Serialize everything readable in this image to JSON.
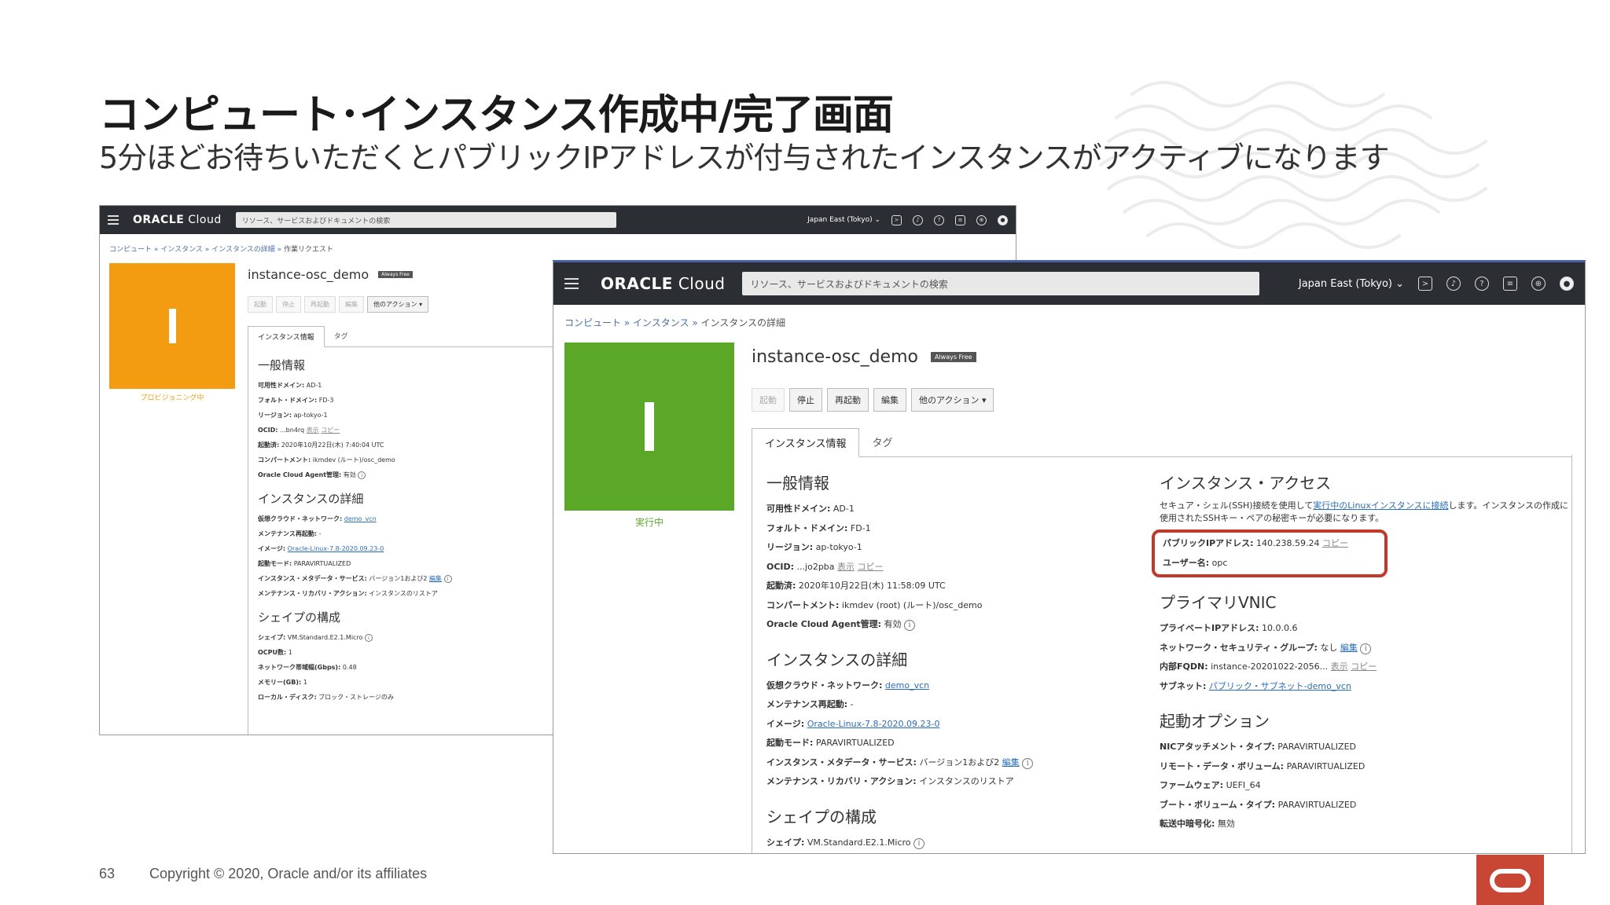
{
  "slide": {
    "title": "コンピュート･インスタンス作成中/完了画面",
    "subtitle": "5分ほどお待ちいただくとパブリックIPアドレスが付与されたインスタンスがアクティブになります",
    "page_number": "63",
    "copyright": "Copyright © 2020, Oracle and/or its affiliates",
    "brand_color": "#c74634"
  },
  "console": {
    "logo_bold": "ORACLE",
    "logo_light": " Cloud",
    "search_placeholder": "リソース、サービスおよびドキュメントの検索",
    "region": "Japan East (Tokyo) ⌄",
    "instance_name": "instance-osc_demo",
    "badge": "Always Free",
    "buttons": [
      "起動",
      "停止",
      "再起動",
      "編集",
      "他のアクション ▾"
    ],
    "tabs": [
      "インスタンス情報",
      "タグ"
    ]
  },
  "shot_a": {
    "breadcrumb": [
      "コンピュート",
      "インスタンス",
      "インスタンスの詳細"
    ],
    "breadcrumb_current": "作業リクエスト",
    "state": "プロビジョニング中",
    "tile_color": "#f39c12",
    "general_title": "一般情報",
    "general": {
      "ad_k": "可用性ドメイン:",
      "ad_v": " AD-1",
      "fd_k": "フォルト・ドメイン:",
      "fd_v": " FD-3",
      "region_k": "リージョン:",
      "region_v": " ap-tokyo-1",
      "ocid_k": "OCID:",
      "ocid_v": " ...bn4rq ",
      "show": "表示",
      "copy": "コピー",
      "started_k": "起動済:",
      "started_v": " 2020年10月22日(木) 7:40:04 UTC",
      "comp_k": "コンパートメント:",
      "comp_v": " ikmdev (ルート)/osc_demo",
      "agent_k": "Oracle Cloud Agent管理:",
      "agent_v": " 有効"
    },
    "details_title": "インスタンスの詳細",
    "details": {
      "vcn_k": "仮想クラウド・ネットワーク:",
      "vcn_v": "demo_vcn",
      "maint_k": "メンテナンス再起動:",
      "maint_v": " -",
      "image_k": "イメージ:",
      "image_v": "Oracle-Linux-7.8-2020.09.23-0",
      "mode_k": "起動モード:",
      "mode_v": " PARAVIRTUALIZED",
      "meta_k": "インスタンス・メタデータ・サービス:",
      "meta_v": " バージョン1および2 ",
      "edit": "編集",
      "recov_k": "メンテナンス・リカバリ・アクション:",
      "recov_v": " インスタンスのリストア"
    },
    "shape_title": "シェイプの構成",
    "shape": {
      "shape_k": "シェイプ:",
      "shape_v": " VM.Standard.E2.1.Micro",
      "ocpu_k": "OCPU数:",
      "ocpu_v": " 1",
      "bw_k": "ネットワーク帯域幅(Gbps):",
      "bw_v": " 0.48",
      "mem_k": "メモリー(GB):",
      "mem_v": " 1",
      "disk_k": "ローカル・ディスク:",
      "disk_v": " ブロック・ストレージのみ"
    }
  },
  "shot_b": {
    "breadcrumb": [
      "コンピュート",
      "インスタンス"
    ],
    "breadcrumb_current": "インスタンスの詳細",
    "state": "実行中",
    "tile_color": "#5ba829",
    "general_title": "一般情報",
    "general": {
      "ad_k": "可用性ドメイン:",
      "ad_v": " AD-1",
      "fd_k": "フォルト・ドメイン:",
      "fd_v": " FD-1",
      "region_k": "リージョン:",
      "region_v": " ap-tokyo-1",
      "ocid_k": "OCID:",
      "ocid_v": " ...jo2pba ",
      "show": "表示",
      "copy": "コピー",
      "started_k": "起動済:",
      "started_v": " 2020年10月22日(木) 11:58:09 UTC",
      "comp_k": "コンパートメント:",
      "comp_v": " ikmdev (root) (ルート)/osc_demo",
      "agent_k": "Oracle Cloud Agent管理:",
      "agent_v": " 有効"
    },
    "details_title": "インスタンスの詳細",
    "details": {
      "vcn_k": "仮想クラウド・ネットワーク:",
      "vcn_v": "demo_vcn",
      "maint_k": "メンテナンス再起動:",
      "maint_v": " -",
      "image_k": "イメージ:",
      "image_v": "Oracle-Linux-7.8-2020.09.23-0",
      "mode_k": "起動モード:",
      "mode_v": " PARAVIRTUALIZED",
      "meta_k": "インスタンス・メタデータ・サービス:",
      "meta_v": " バージョン1および2 ",
      "edit": "編集",
      "recov_k": "メンテナンス・リカバリ・アクション:",
      "recov_v": " インスタンスのリストア"
    },
    "shape_title": "シェイプの構成",
    "shape": {
      "shape_k": "シェイプ:",
      "shape_v": " VM.Standard.E2.1.Micro"
    },
    "access_title": "インスタンス・アクセス",
    "access_desc_pre": "セキュア・シェル(SSH)接続を使用して",
    "access_desc_link": "実行中のLinuxインスタンスに接続",
    "access_desc_post": "します。インスタンスの作成に使用されたSSHキー・ペアの秘密キーが必要になります。",
    "access": {
      "pip_k": "パブリックIPアドレス:",
      "pip_v": " 140.238.59.24 ",
      "copy": "コピー",
      "user_k": "ユーザー名:",
      "user_v": " opc"
    },
    "vnic_title": "プライマリVNIC",
    "vnic": {
      "priv_k": "プライベートIPアドレス:",
      "priv_v": " 10.0.0.6",
      "nsg_k": "ネットワーク・セキュリティ・グループ:",
      "nsg_v": " なし ",
      "edit": "編集",
      "fqdn_k": "内部FQDN:",
      "fqdn_v": " instance-20201022-2056... ",
      "show": "表示",
      "copy": "コピー",
      "subnet_k": "サブネット:",
      "subnet_v": "パブリック・サブネット-demo_vcn"
    },
    "launch_title": "起動オプション",
    "launch": {
      "nic_k": "NICアタッチメント・タイプ:",
      "nic_v": " PARAVIRTUALIZED",
      "rvol_k": "リモート・データ・ボリューム:",
      "rvol_v": " PARAVIRTUALIZED",
      "fw_k": "ファームウェア:",
      "fw_v": " UEFI_64",
      "boot_k": "ブート・ボリューム・タイプ:",
      "boot_v": " PARAVIRTUALIZED",
      "enc_k": "転送中暗号化:",
      "enc_v": " 無効"
    }
  }
}
